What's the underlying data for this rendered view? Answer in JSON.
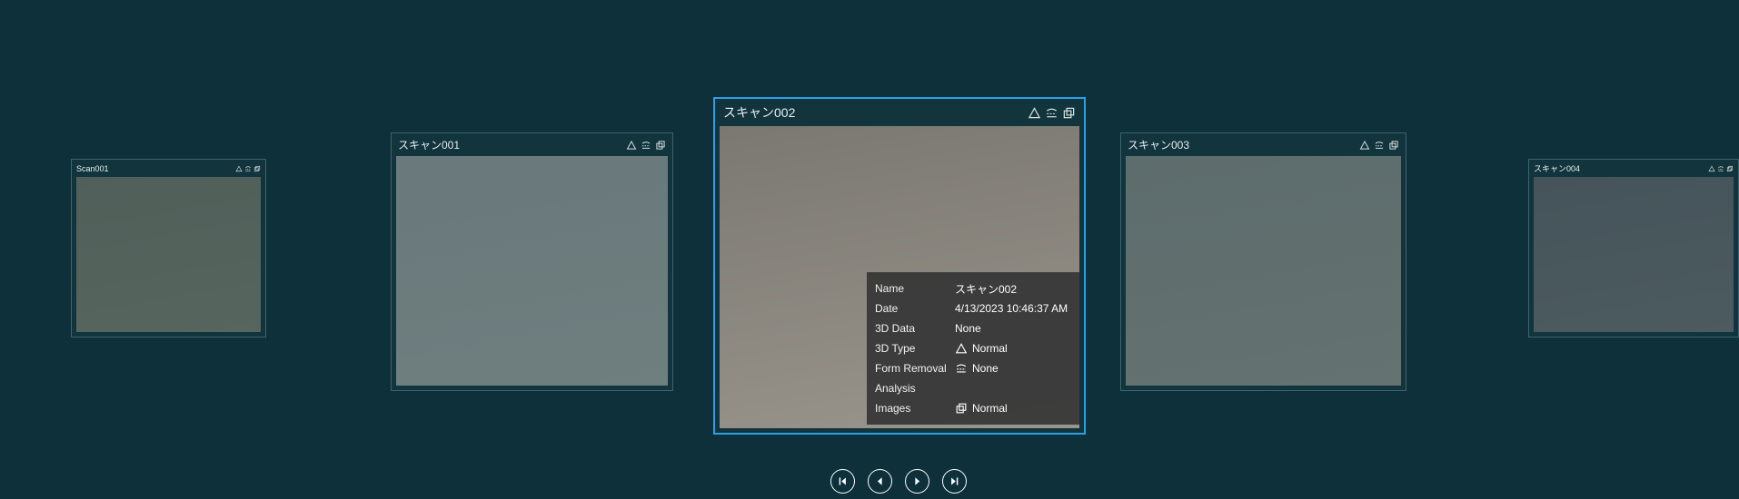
{
  "page": {
    "background": "#0d303a",
    "selected_border": "#2f9fe4"
  },
  "cards": [
    {
      "title": "Scan001",
      "selected": false,
      "thumb_top": "#505f59",
      "thumb_bottom": "#57655f",
      "icons": [
        "3d-type-triangle",
        "form-removal",
        "images"
      ]
    },
    {
      "title": "スキャン001",
      "selected": false,
      "thumb_top": "#69797c",
      "thumb_bottom": "#6f7e7e",
      "icons": [
        "3d-type-triangle",
        "form-removal",
        "images"
      ]
    },
    {
      "title": "スキャン002",
      "selected": true,
      "thumb_top": "#7b7872",
      "thumb_bottom": "#99958c",
      "icons": [
        "3d-type-triangle",
        "form-removal",
        "images"
      ]
    },
    {
      "title": "スキャン003",
      "selected": false,
      "thumb_top": "#5d6c6c",
      "thumb_bottom": "#647271",
      "icons": [
        "3d-type-triangle",
        "form-removal",
        "images"
      ]
    },
    {
      "title": "スキャン004",
      "selected": false,
      "thumb_top": "#45545a",
      "thumb_bottom": "#4c5b5f",
      "icons": [
        "3d-type-triangle",
        "form-removal",
        "images"
      ]
    }
  ],
  "info_panel": {
    "rows": [
      {
        "label": "Name",
        "icon": "",
        "value": "スキャン002"
      },
      {
        "label": "Date",
        "icon": "",
        "value": "4/13/2023 10:46:37 AM"
      },
      {
        "label": "3D Data",
        "icon": "",
        "value": "None"
      },
      {
        "label": "3D Type",
        "icon": "3d-type-triangle",
        "value": "Normal"
      },
      {
        "label": "Form Removal",
        "icon": "form-removal",
        "value": "None"
      },
      {
        "label": "Analysis",
        "icon": "",
        "value": ""
      },
      {
        "label": "Images",
        "icon": "images",
        "value": "Normal"
      }
    ]
  },
  "nav": {
    "first": "First scan",
    "previous": "Previous scan",
    "next": "Next scan",
    "last": "Last scan"
  }
}
